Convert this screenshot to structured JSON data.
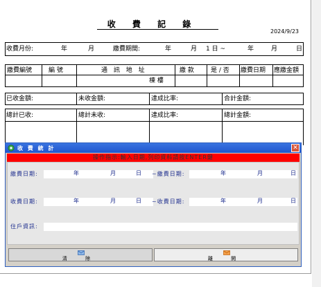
{
  "document": {
    "title": "收 費 記 錄",
    "date": "2024/9/23",
    "row1": {
      "fee_month_label": "收費月份:",
      "year": "年",
      "month": "月",
      "period_label": "繳費期間:",
      "p_year": "年",
      "p_month": "月",
      "p_day": "1 日 ~",
      "p_year2": "年",
      "p_month2": "月",
      "p_day2": "日"
    },
    "table_headers": [
      "繳費編號",
      "編 號",
      "通 訊 地 址",
      "繳 款",
      "是 / 否",
      "繳費日期",
      "應繳金額"
    ],
    "subheader": "棟 樓",
    "summary1": {
      "received": "已收金額:",
      "unreceived": "未收金額:",
      "ratio": "達成比率:",
      "total": "合計金額:"
    },
    "summary2": {
      "received": "總計已收:",
      "unreceived": "總計未收:",
      "ratio": "達成比率:",
      "total": "總計金額:"
    }
  },
  "dialog": {
    "title": "收 費 統 計",
    "close_symbol": "✕",
    "banner": "操作指示:輸入日期,列印資料請按ENTER鍵",
    "row1": {
      "label": "繳費日期:",
      "year": "年",
      "month": "月",
      "day": "日",
      "sep_label": "~繳費日期:",
      "year2": "年",
      "month2": "月",
      "day2": "日"
    },
    "row2": {
      "label": "收費日期:",
      "year": "年",
      "month": "月",
      "day": "日",
      "sep_label": "~收費日期:",
      "year2": "年",
      "month2": "月",
      "day2": "日"
    },
    "resident_label": "住戶資訊:",
    "buttons": {
      "clear": "清 除",
      "exit": "離 開"
    },
    "icons": {
      "dialog": "green-gear-icon",
      "clear": "envelope-icon",
      "exit": "envelope-icon"
    },
    "colors": {
      "banner": "#ff0000",
      "titlebar": "#1f56cf",
      "label": "#1f2f8f"
    }
  }
}
